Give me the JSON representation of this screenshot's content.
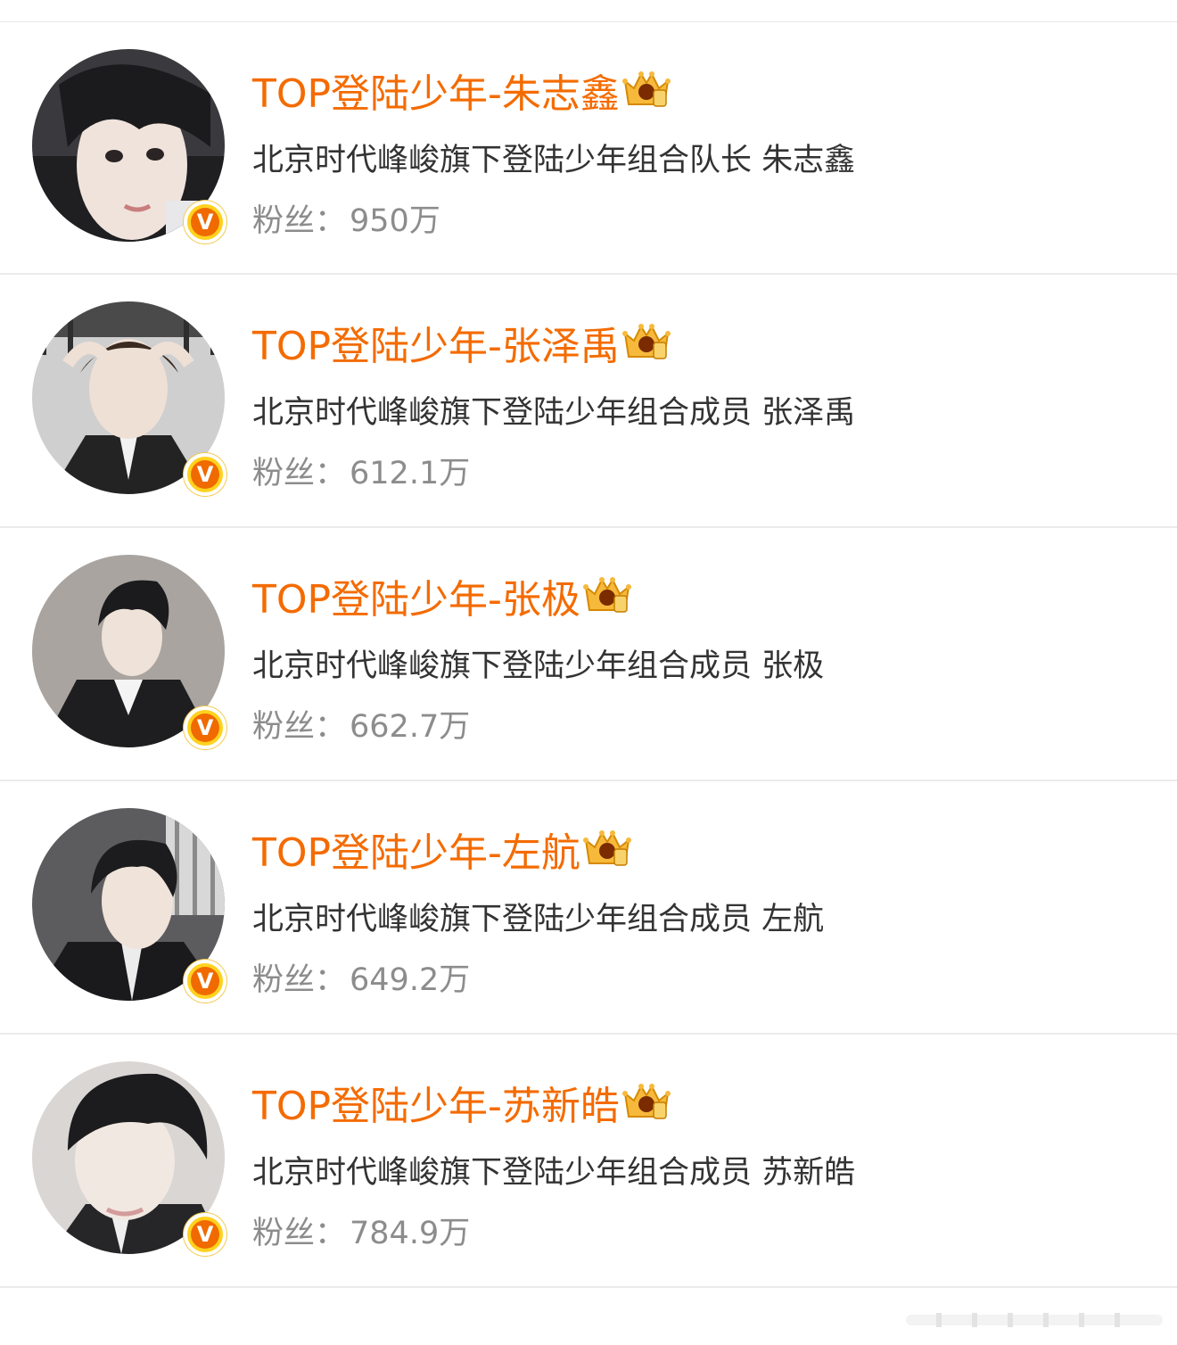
{
  "users": [
    {
      "name": "TOP登陆少年-朱志鑫",
      "description": "北京时代峰峻旗下登陆少年组合队长 朱志鑫",
      "fans_label": "粉丝：",
      "fans_count": "950万",
      "badge": "crown-member-icon",
      "verified": "V"
    },
    {
      "name": "TOP登陆少年-张泽禹",
      "description": "北京时代峰峻旗下登陆少年组合成员 张泽禹",
      "fans_label": "粉丝：",
      "fans_count": "612.1万",
      "badge": "crown-member-icon",
      "verified": "V"
    },
    {
      "name": "TOP登陆少年-张极",
      "description": "北京时代峰峻旗下登陆少年组合成员 张极",
      "fans_label": "粉丝：",
      "fans_count": "662.7万",
      "badge": "crown-member-icon",
      "verified": "V"
    },
    {
      "name": "TOP登陆少年-左航",
      "description": "北京时代峰峻旗下登陆少年组合成员 左航",
      "fans_label": "粉丝：",
      "fans_count": "649.2万",
      "badge": "crown-member-icon",
      "verified": "V"
    },
    {
      "name": "TOP登陆少年-苏新皓",
      "description": "北京时代峰峻旗下登陆少年组合成员 苏新皓",
      "fans_label": "粉丝：",
      "fans_count": "784.9万",
      "badge": "crown-member-icon",
      "verified": "V"
    }
  ],
  "colors": {
    "name": "#f46b00",
    "description": "#333333",
    "fans": "#8c8c8c",
    "verified_badge": "#f06a00",
    "divider": "#ebebeb"
  }
}
